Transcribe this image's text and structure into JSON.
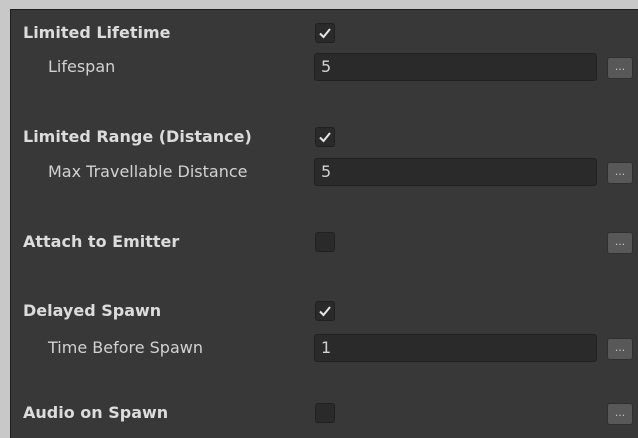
{
  "colors": {
    "panel_bg": "#383838",
    "field_bg": "#2a2a2a",
    "button_bg": "#585858",
    "text": "#d2d2d2"
  },
  "sections": {
    "lifetime": {
      "label": "Limited Lifetime",
      "checked": true,
      "sub_label": "Lifespan",
      "value": "5",
      "more_label": "..."
    },
    "range": {
      "label": "Limited Range (Distance)",
      "checked": true,
      "sub_label": "Max Travellable Distance",
      "value": "5",
      "more_label": "..."
    },
    "attach": {
      "label": "Attach to Emitter",
      "checked": false,
      "more_label": "..."
    },
    "delayed": {
      "label": "Delayed Spawn",
      "checked": true,
      "sub_label": "Time Before Spawn",
      "value": "1",
      "more_label": "..."
    },
    "audio": {
      "label": "Audio on Spawn",
      "checked": false,
      "more_label": "..."
    }
  }
}
